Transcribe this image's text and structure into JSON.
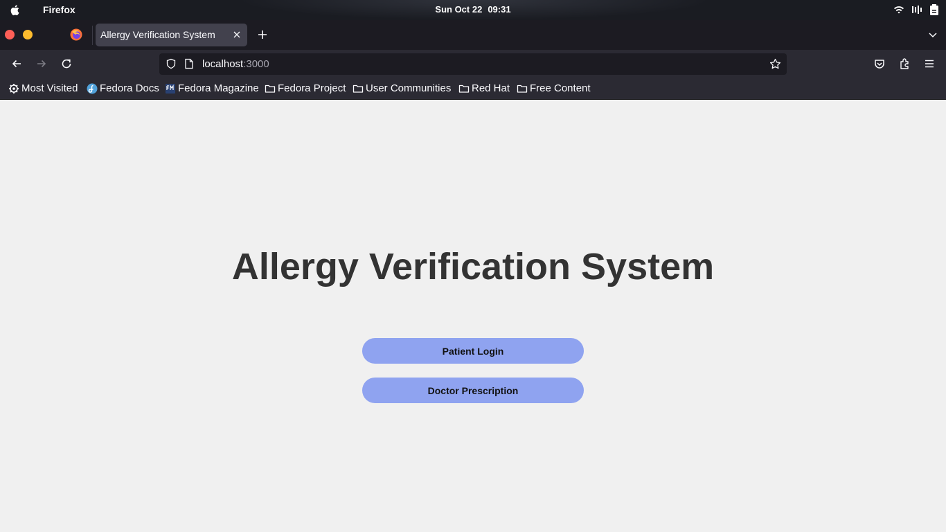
{
  "os": {
    "app_name": "Firefox",
    "date": "Sun Oct 22",
    "time": "09:31"
  },
  "browser": {
    "tab_title": "Allergy Verification System",
    "url_host": "localhost",
    "url_port": ":3000",
    "bookmarks": [
      {
        "label": "Most Visited",
        "icon": "gear-icon"
      },
      {
        "label": "Fedora Docs",
        "icon": "fedora-icon"
      },
      {
        "label": "Fedora Magazine",
        "icon": "fedora-magazine-icon"
      },
      {
        "label": "Fedora Project",
        "icon": "folder-icon"
      },
      {
        "label": "User Communities",
        "icon": "folder-icon"
      },
      {
        "label": "Red Hat",
        "icon": "folder-icon"
      },
      {
        "label": "Free Content",
        "icon": "folder-icon"
      }
    ]
  },
  "page": {
    "title": "Allergy Verification System",
    "buttons": {
      "patient_login": "Patient Login",
      "doctor_prescription": "Doctor Prescription"
    }
  },
  "colors": {
    "page_bg": "#f0f0f0",
    "button_bg": "#8fa3f0",
    "title_text": "#333333",
    "chrome_dark": "#1c1b22",
    "toolbar": "#2b2a33"
  }
}
